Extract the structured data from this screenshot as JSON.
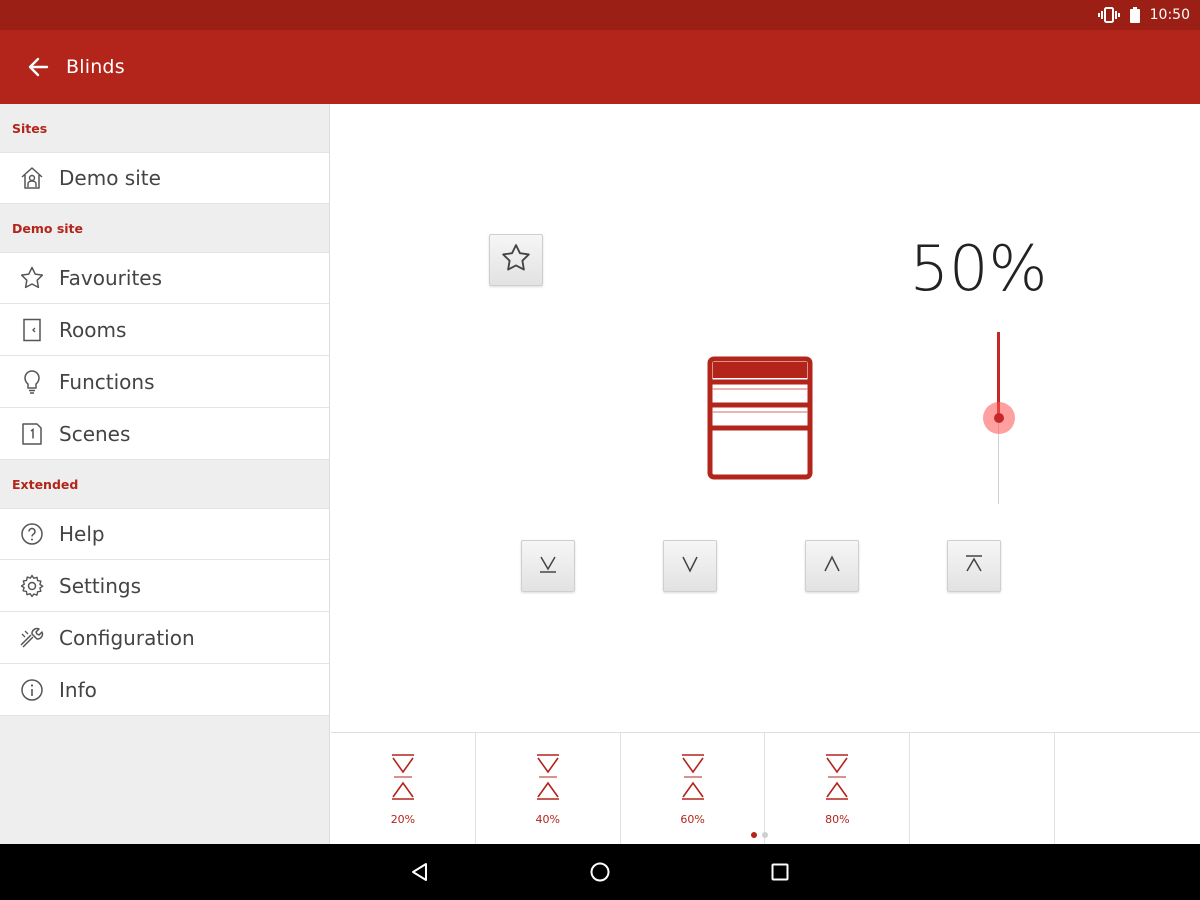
{
  "status_bar": {
    "time": "10:50"
  },
  "app_bar": {
    "title": "Blinds"
  },
  "drawer": {
    "sections": [
      {
        "header": "Sites",
        "items": [
          {
            "label": "Demo site",
            "icon": "house-icon"
          }
        ]
      },
      {
        "header": "Demo site",
        "items": [
          {
            "label": "Favourites",
            "icon": "star-icon"
          },
          {
            "label": "Rooms",
            "icon": "door-icon"
          },
          {
            "label": "Functions",
            "icon": "bulb-icon"
          },
          {
            "label": "Scenes",
            "icon": "scene-icon"
          }
        ]
      },
      {
        "header": "Extended",
        "items": [
          {
            "label": "Help",
            "icon": "help-icon"
          },
          {
            "label": "Settings",
            "icon": "gear-icon"
          },
          {
            "label": "Configuration",
            "icon": "wrench-icon"
          },
          {
            "label": "Info",
            "icon": "info-icon"
          }
        ]
      }
    ]
  },
  "blind": {
    "position_label": "50%",
    "position_value": 50,
    "accent_color": "#b3241b",
    "controls": [
      {
        "name": "fully-down",
        "icon": "arrow-down-bar-icon"
      },
      {
        "name": "down",
        "icon": "chevron-down-icon"
      },
      {
        "name": "up",
        "icon": "chevron-up-icon"
      },
      {
        "name": "fully-up",
        "icon": "arrow-up-bar-icon"
      }
    ]
  },
  "presets": [
    {
      "label": "20%"
    },
    {
      "label": "40%"
    },
    {
      "label": "60%"
    },
    {
      "label": "80%"
    },
    {
      "label": ""
    },
    {
      "label": ""
    }
  ],
  "pager": {
    "pages": 2,
    "active": 0
  }
}
